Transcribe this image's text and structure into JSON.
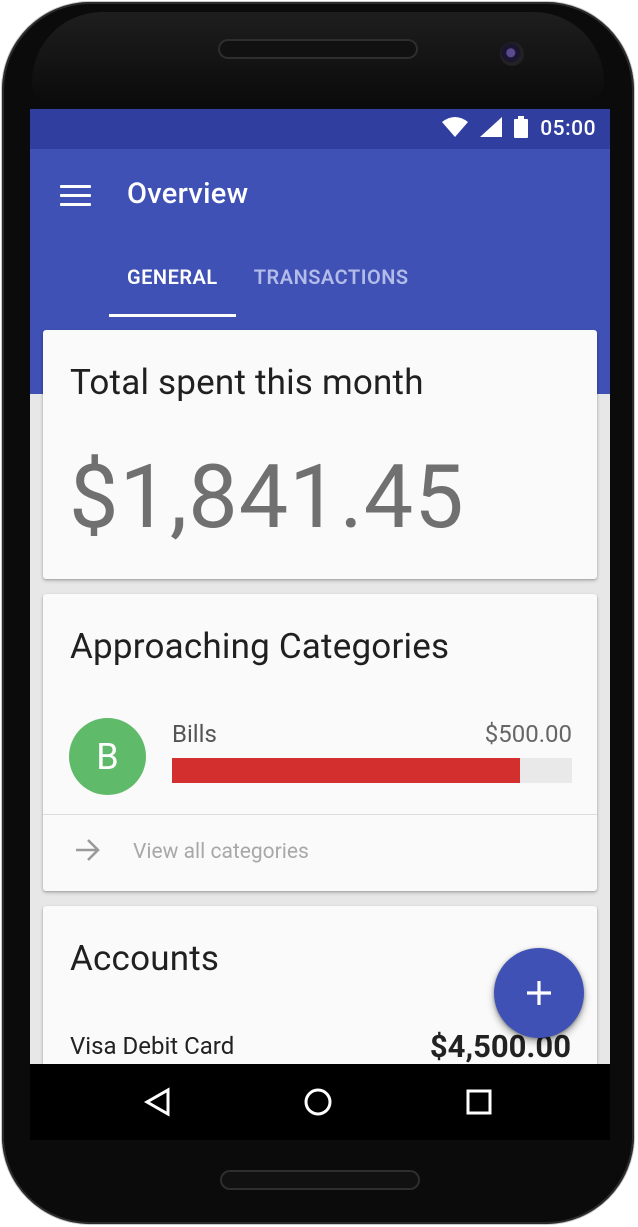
{
  "status_bar": {
    "time": "05:00",
    "icons": [
      "wifi-icon",
      "signal-icon",
      "battery-icon"
    ]
  },
  "app_bar": {
    "title": "Overview",
    "menu_icon": "hamburger-menu-icon",
    "tabs": [
      {
        "label": "GENERAL",
        "active": true
      },
      {
        "label": "TRANSACTIONS",
        "active": false
      }
    ],
    "color": "#3f51b5",
    "status_color": "#303f9f"
  },
  "total_card": {
    "heading": "Total spent this month",
    "amount": "$1,841.45"
  },
  "categories_card": {
    "heading": "Approaching Categories",
    "items": [
      {
        "avatar_letter": "B",
        "name": "Bills",
        "amount": "$500.00",
        "progress": 0.87,
        "bar_color": "#d32f2f",
        "avatar_color": "#5fba6a"
      }
    ],
    "view_all_label": "View all categories"
  },
  "accounts_card": {
    "heading": "Accounts",
    "accounts": [
      {
        "name": "Visa Debit Card",
        "balance": "$4,500.00"
      }
    ]
  },
  "fab": {
    "icon": "plus-icon"
  },
  "nav_bar": {
    "icons": [
      "back-icon",
      "home-icon",
      "recents-icon"
    ]
  }
}
